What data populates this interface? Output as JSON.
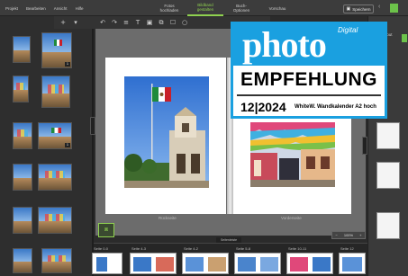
{
  "menu": [
    "Projekt",
    "Bearbeiten",
    "Ansicht",
    "Hilfe"
  ],
  "tabs": [
    {
      "label": "Fotos\nhochladen",
      "active": false
    },
    {
      "label": "Bildband\ngestalten",
      "active": true
    },
    {
      "label": "Buch-\nOptionen",
      "active": false
    },
    {
      "label": "Vorschau",
      "active": false
    }
  ],
  "save_label": "Speichern",
  "colors": {
    "accent": "#8fd14f",
    "award_blue": "#1aa0e0",
    "flag_green": "#1f8a3c",
    "flag_red": "#c8202a"
  },
  "canvas": {
    "left_page_label": "Rückseite",
    "right_page_label": "Vorderseite",
    "zoom": "100%"
  },
  "right_panel": {
    "label": "Layout"
  },
  "strip": {
    "toggle_label": "Seitenleiste",
    "spreads": [
      "Seite 0-0",
      "Seite 4-3",
      "Seite 4-2",
      "Seite 5-8",
      "Seite 10-11",
      "Seite 12"
    ]
  },
  "award": {
    "digital": "Digital",
    "brand": "photo",
    "headline": "EMPFEHLUNG",
    "issue": "12|2024",
    "product": "WhiteW. Wandkalender A2 hoch"
  },
  "icons": [
    "undo-icon",
    "redo-icon",
    "align-icon",
    "text-icon",
    "image-icon",
    "crop-icon",
    "frame-icon",
    "circle-icon"
  ]
}
